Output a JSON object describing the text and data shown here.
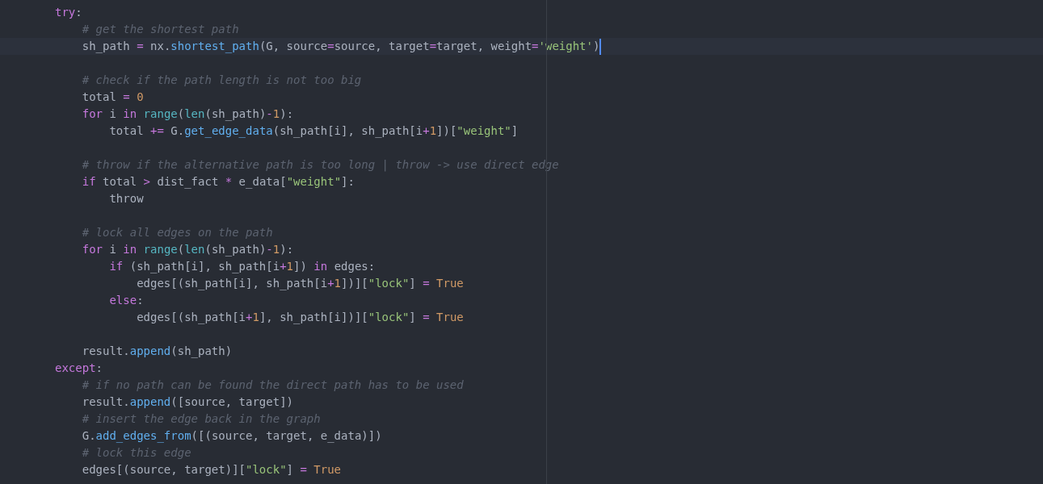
{
  "lines": [
    {
      "current": false,
      "tokens": [
        {
          "text": "try",
          "kind": "keyword"
        },
        {
          "text": ":",
          "kind": "plain"
        }
      ]
    },
    {
      "current": false,
      "tokens": [
        {
          "text": "    # get the shortest path",
          "kind": "comment"
        }
      ]
    },
    {
      "current": true,
      "tokens": [
        {
          "text": "    sh_path ",
          "kind": "plain"
        },
        {
          "text": "=",
          "kind": "operator"
        },
        {
          "text": " nx.",
          "kind": "plain"
        },
        {
          "text": "shortest_path",
          "kind": "function"
        },
        {
          "text": "(G, source",
          "kind": "plain"
        },
        {
          "text": "=",
          "kind": "operator"
        },
        {
          "text": "source, target",
          "kind": "plain"
        },
        {
          "text": "=",
          "kind": "operator"
        },
        {
          "text": "target, weight",
          "kind": "plain"
        },
        {
          "text": "=",
          "kind": "operator"
        },
        {
          "text": "'weight'",
          "kind": "string"
        },
        {
          "text": ")",
          "kind": "plain"
        }
      ]
    },
    {
      "current": false
    },
    {
      "current": false,
      "tokens": [
        {
          "text": "    # check if the path length is not too big",
          "kind": "comment"
        }
      ]
    },
    {
      "current": false,
      "tokens": [
        {
          "text": "    total ",
          "kind": "plain"
        },
        {
          "text": "=",
          "kind": "operator"
        },
        {
          "text": " 0",
          "kind": "number"
        }
      ]
    },
    {
      "current": false,
      "tokens": [
        {
          "text": "    for",
          "kind": "keyword"
        },
        {
          "text": " i ",
          "kind": "plain"
        },
        {
          "text": "in",
          "kind": "keyword"
        },
        {
          "text": " range",
          "kind": "builtin"
        },
        {
          "text": "(",
          "kind": "plain"
        },
        {
          "text": "len",
          "kind": "builtin"
        },
        {
          "text": "(sh_path)",
          "kind": "plain"
        },
        {
          "text": "-",
          "kind": "operator"
        },
        {
          "text": "1",
          "kind": "number"
        },
        {
          "text": "):",
          "kind": "plain"
        }
      ]
    },
    {
      "current": false,
      "tokens": [
        {
          "text": "        total ",
          "kind": "plain"
        },
        {
          "text": "+=",
          "kind": "operator"
        },
        {
          "text": " G.",
          "kind": "plain"
        },
        {
          "text": "get_edge_data",
          "kind": "function"
        },
        {
          "text": "(sh_path[i], sh_path[i",
          "kind": "plain"
        },
        {
          "text": "+",
          "kind": "operator"
        },
        {
          "text": "1",
          "kind": "number"
        },
        {
          "text": "])[",
          "kind": "plain"
        },
        {
          "text": "\"weight\"",
          "kind": "string"
        },
        {
          "text": "]",
          "kind": "plain"
        }
      ]
    },
    {
      "current": false
    },
    {
      "current": false,
      "tokens": [
        {
          "text": "    # throw if the alternative path is too long | throw -> use direct edge",
          "kind": "comment"
        }
      ]
    },
    {
      "current": false,
      "tokens": [
        {
          "text": "    if",
          "kind": "keyword"
        },
        {
          "text": " total ",
          "kind": "plain"
        },
        {
          "text": ">",
          "kind": "operator"
        },
        {
          "text": " dist_fact ",
          "kind": "plain"
        },
        {
          "text": "*",
          "kind": "operator"
        },
        {
          "text": " e_data[",
          "kind": "plain"
        },
        {
          "text": "\"weight\"",
          "kind": "string"
        },
        {
          "text": "]:",
          "kind": "plain"
        }
      ]
    },
    {
      "current": false,
      "tokens": [
        {
          "text": "        throw",
          "kind": "plain"
        }
      ]
    },
    {
      "current": false
    },
    {
      "current": false,
      "tokens": [
        {
          "text": "    # lock all edges on the path",
          "kind": "comment"
        }
      ]
    },
    {
      "current": false,
      "tokens": [
        {
          "text": "    for",
          "kind": "keyword"
        },
        {
          "text": " i ",
          "kind": "plain"
        },
        {
          "text": "in",
          "kind": "keyword"
        },
        {
          "text": " range",
          "kind": "builtin"
        },
        {
          "text": "(",
          "kind": "plain"
        },
        {
          "text": "len",
          "kind": "builtin"
        },
        {
          "text": "(sh_path)",
          "kind": "plain"
        },
        {
          "text": "-",
          "kind": "operator"
        },
        {
          "text": "1",
          "kind": "number"
        },
        {
          "text": "):",
          "kind": "plain"
        }
      ]
    },
    {
      "current": false,
      "tokens": [
        {
          "text": "        if",
          "kind": "keyword"
        },
        {
          "text": " (sh_path[i], sh_path[i",
          "kind": "plain"
        },
        {
          "text": "+",
          "kind": "operator"
        },
        {
          "text": "1",
          "kind": "number"
        },
        {
          "text": "]) ",
          "kind": "plain"
        },
        {
          "text": "in",
          "kind": "keyword"
        },
        {
          "text": " edges:",
          "kind": "plain"
        }
      ]
    },
    {
      "current": false,
      "tokens": [
        {
          "text": "            edges[(sh_path[i], sh_path[i",
          "kind": "plain"
        },
        {
          "text": "+",
          "kind": "operator"
        },
        {
          "text": "1",
          "kind": "number"
        },
        {
          "text": "])][",
          "kind": "plain"
        },
        {
          "text": "\"lock\"",
          "kind": "string"
        },
        {
          "text": "] ",
          "kind": "plain"
        },
        {
          "text": "=",
          "kind": "operator"
        },
        {
          "text": " True",
          "kind": "constant"
        }
      ]
    },
    {
      "current": false,
      "tokens": [
        {
          "text": "        else",
          "kind": "keyword"
        },
        {
          "text": ":",
          "kind": "plain"
        }
      ]
    },
    {
      "current": false,
      "tokens": [
        {
          "text": "            edges[(sh_path[i",
          "kind": "plain"
        },
        {
          "text": "+",
          "kind": "operator"
        },
        {
          "text": "1",
          "kind": "number"
        },
        {
          "text": "], sh_path[i])][",
          "kind": "plain"
        },
        {
          "text": "\"lock\"",
          "kind": "string"
        },
        {
          "text": "] ",
          "kind": "plain"
        },
        {
          "text": "=",
          "kind": "operator"
        },
        {
          "text": " True",
          "kind": "constant"
        }
      ]
    },
    {
      "current": false
    },
    {
      "current": false,
      "tokens": [
        {
          "text": "    result.",
          "kind": "plain"
        },
        {
          "text": "append",
          "kind": "function"
        },
        {
          "text": "(sh_path)",
          "kind": "plain"
        }
      ]
    },
    {
      "current": false,
      "tokens": [
        {
          "text": "except",
          "kind": "keyword"
        },
        {
          "text": ":",
          "kind": "plain"
        }
      ]
    },
    {
      "current": false,
      "tokens": [
        {
          "text": "    # if no path can be found the direct path has to be used",
          "kind": "comment"
        }
      ]
    },
    {
      "current": false,
      "tokens": [
        {
          "text": "    result.",
          "kind": "plain"
        },
        {
          "text": "append",
          "kind": "function"
        },
        {
          "text": "([source, target])",
          "kind": "plain"
        }
      ]
    },
    {
      "current": false,
      "tokens": [
        {
          "text": "    # insert the edge back in the graph",
          "kind": "comment"
        }
      ]
    },
    {
      "current": false,
      "tokens": [
        {
          "text": "    G.",
          "kind": "plain"
        },
        {
          "text": "add_edges_from",
          "kind": "function"
        },
        {
          "text": "([(source, target, e_data)])",
          "kind": "plain"
        }
      ]
    },
    {
      "current": false,
      "tokens": [
        {
          "text": "    # lock this edge",
          "kind": "comment"
        }
      ]
    },
    {
      "current": false,
      "tokens": [
        {
          "text": "    edges[(source, target)][",
          "kind": "plain"
        },
        {
          "text": "\"lock\"",
          "kind": "string"
        },
        {
          "text": "] ",
          "kind": "plain"
        },
        {
          "text": "=",
          "kind": "operator"
        },
        {
          "text": " True",
          "kind": "constant"
        }
      ]
    }
  ]
}
